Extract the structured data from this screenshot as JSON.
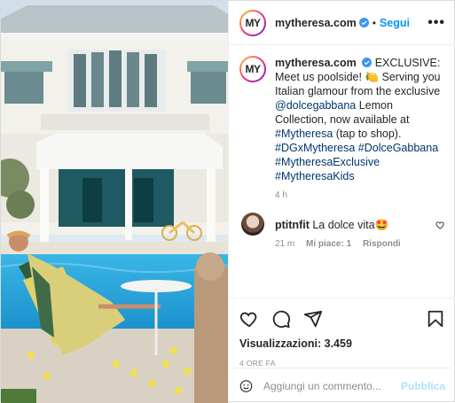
{
  "header": {
    "username": "mytheresa.com",
    "separator": "•",
    "follow_label": "Segui",
    "more_label": "•••",
    "avatar_text": "MY"
  },
  "caption": {
    "username": "mytheresa.com",
    "text_part1": "EXCLUSIVE: Meet us poolside! ",
    "emoji_lemon": "🍋",
    "text_part2": " Serving you Italian glamour from the exclusive ",
    "mention": "@dolcegabbana",
    "text_part3": " Lemon Collection, now available at ",
    "hashtag1": "#Mytheresa",
    "text_part4": " (tap to shop). ",
    "hashtag2": "#DGxMytheresa",
    "hashtag3": "#DolceGabbana",
    "hashtag4": "#MytheresaExclusive",
    "hashtag5": "#MytheresaKids",
    "time": "4 h"
  },
  "comment": {
    "username": "ptitnfit",
    "text": "La dolce vita",
    "emoji": "🤩",
    "time": "21 m",
    "likes": "Mi piace: 1",
    "reply": "Rispondi"
  },
  "stats": {
    "views": "Visualizzazioni: 3.459",
    "date": "4 ORE FA"
  },
  "add_comment": {
    "placeholder": "Aggiungi un commento...",
    "publish_label": "Pubblica"
  },
  "colors": {
    "accent": "#0095f6",
    "link": "#00376b",
    "muted": "#8e8e8e"
  },
  "icons": [
    "heart-icon",
    "comment-icon",
    "share-icon",
    "save-icon",
    "emoji-icon",
    "verified-icon",
    "more-icon"
  ]
}
